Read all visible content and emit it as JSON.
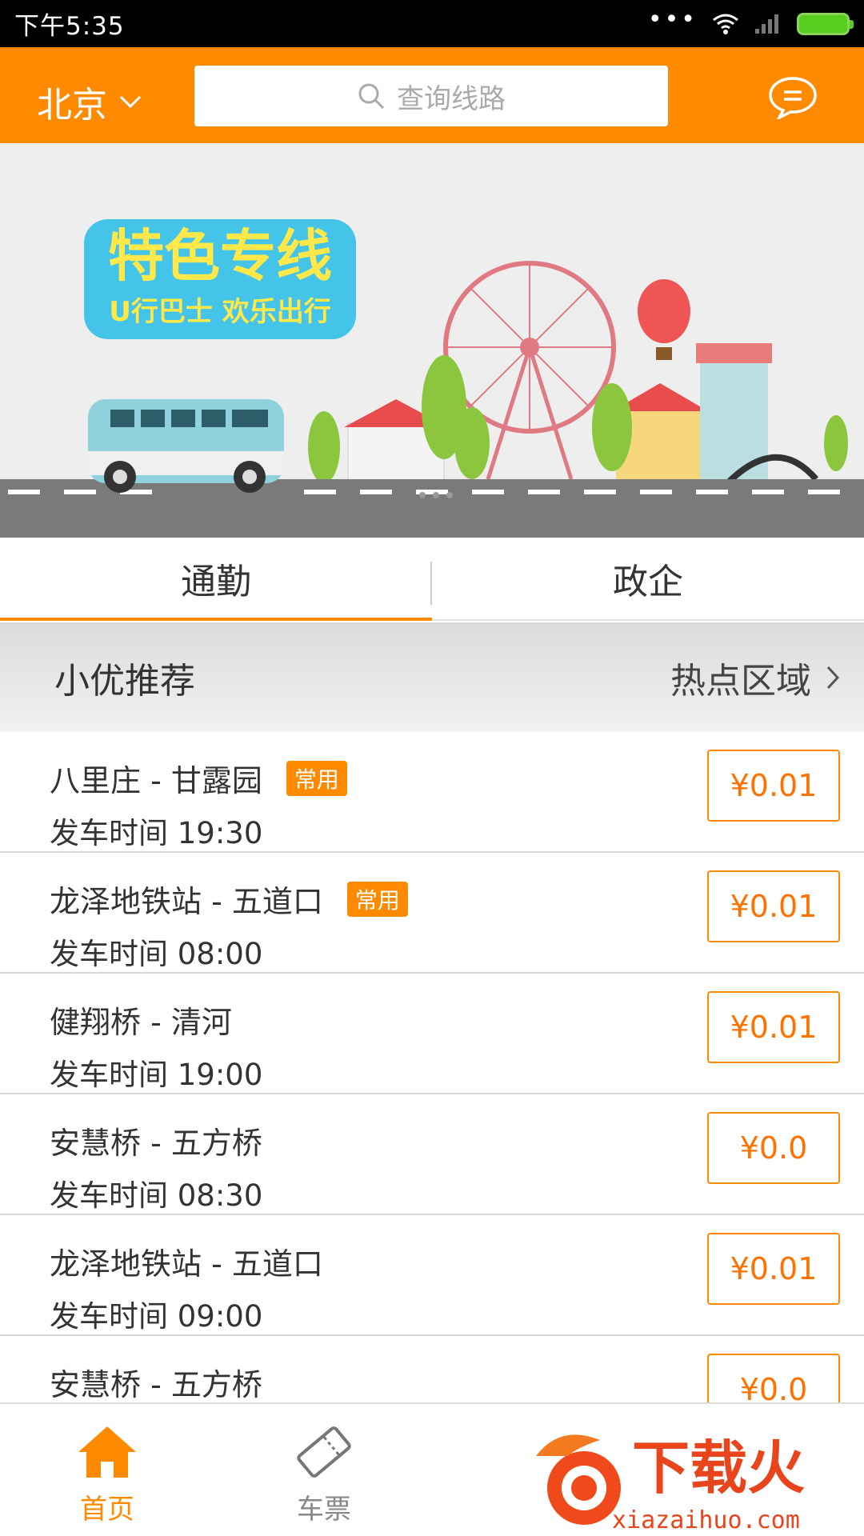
{
  "status_bar": {
    "time": "下午5:35",
    "dots": "•••"
  },
  "header": {
    "city": "北京",
    "search_placeholder": "查询线路"
  },
  "banner": {
    "title": "特色专线",
    "subtitle": "U行巴士 欢乐出行"
  },
  "tabs": [
    {
      "label": "通勤",
      "active": true
    },
    {
      "label": "政企",
      "active": false
    }
  ],
  "section": {
    "title": "小优推荐",
    "hot_link": "热点区域"
  },
  "routes": [
    {
      "name": "八里庄 - 甘露园",
      "tag": "常用",
      "time": "发车时间 19:30",
      "price": "¥0.01"
    },
    {
      "name": "龙泽地铁站 - 五道口",
      "tag": "常用",
      "time": "发车时间 08:00",
      "price": "¥0.01"
    },
    {
      "name": "健翔桥 - 清河",
      "tag": "",
      "time": "发车时间 19:00",
      "price": "¥0.01"
    },
    {
      "name": "安慧桥 - 五方桥",
      "tag": "",
      "time": "发车时间 08:30",
      "price": "¥0.0"
    },
    {
      "name": "龙泽地铁站 - 五道口",
      "tag": "",
      "time": "发车时间 09:00",
      "price": "¥0.01"
    },
    {
      "name": "安慧桥 - 五方桥",
      "tag": "",
      "time": "",
      "price": "¥0.0"
    }
  ],
  "bottom_nav": [
    {
      "label": "首页",
      "icon": "home-icon",
      "active": true
    },
    {
      "label": "车票",
      "icon": "ticket-icon",
      "active": false
    }
  ],
  "watermark": {
    "brand": "下载火",
    "url": "xiazaihuo.com"
  },
  "colors": {
    "accent": "#ff8a00",
    "price_text": "#ff7200"
  }
}
